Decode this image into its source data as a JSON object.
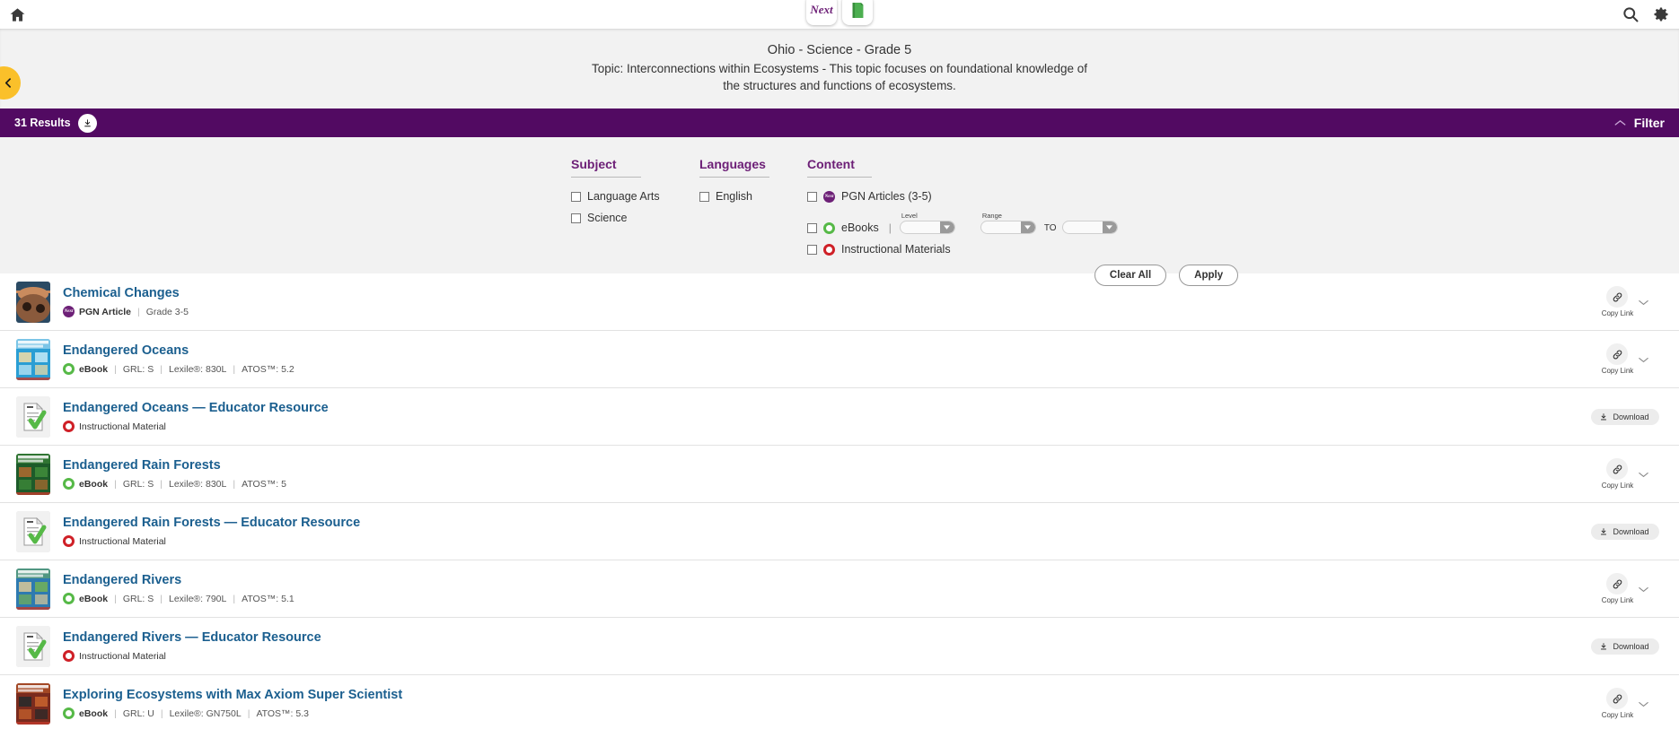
{
  "appbar": {
    "home_icon": "home-icon",
    "next_label": "Next",
    "book_icon": "green-book-icon",
    "search_icon": "search-icon",
    "settings_icon": "gear-icon"
  },
  "header": {
    "back_icon": "chevron-left-icon",
    "title": "Ohio - Science - Grade 5",
    "subtitle": "Topic: Interconnections within Ecosystems - This topic focuses on foundational knowledge of the structures and functions of ecosystems."
  },
  "resultsbar": {
    "count_label": "31 Results",
    "download_icon": "download-icon",
    "filter_label": "Filter",
    "filter_chevron": "chevron-up-icon",
    "bar_color": "#520a62"
  },
  "filters": {
    "subject": {
      "heading": "Subject",
      "options": [
        {
          "label": "Language Arts",
          "checked": false
        },
        {
          "label": "Science",
          "checked": false
        }
      ]
    },
    "languages": {
      "heading": "Languages",
      "options": [
        {
          "label": "English",
          "checked": false
        }
      ]
    },
    "content": {
      "heading": "Content",
      "options": [
        {
          "label": "PGN Articles (3-5)",
          "badge": "pgn-badge-icon",
          "checked": false
        },
        {
          "label": "eBooks",
          "badge": "ebook-badge-icon",
          "checked": false
        },
        {
          "label": "Instructional Materials",
          "badge": "instructional-material-badge-icon",
          "checked": false
        }
      ],
      "level_label": "Level",
      "level_value": "",
      "range_label": "Range",
      "range_from_value": "",
      "range_to_label": "TO",
      "range_to_value": ""
    },
    "clear_all_label": "Clear All",
    "apply_label": "Apply"
  },
  "results": [
    {
      "title": "Chemical Changes",
      "type": "PGN Article",
      "badge": "pgn",
      "meta": [
        "Grade 3-5"
      ],
      "action": "copylink",
      "thumb": "carousel-photo",
      "thumb_colors": [
        "#8a5a3c",
        "#c98b5e",
        "#2b4a63"
      ]
    },
    {
      "title": "Endangered Oceans",
      "type": "eBook",
      "badge": "ebook",
      "meta": [
        "GRL: S",
        "Lexile®: 830L",
        "ATOS™: 5.2"
      ],
      "action": "copylink",
      "thumb": "book-cover-oceans",
      "thumb_colors": [
        "#2a9ed4",
        "#bde5f5",
        "#e8d9a8"
      ]
    },
    {
      "title": "Endangered Oceans — Educator Resource",
      "type": "Instructional Material",
      "badge": "im",
      "meta": [],
      "action": "download",
      "thumb": "worksheet-check",
      "thumb_colors": [
        "#f2f2f2",
        "#ffffff",
        "#56b947"
      ]
    },
    {
      "title": "Endangered Rain Forests",
      "type": "eBook",
      "badge": "ebook",
      "meta": [
        "GRL: S",
        "Lexile®: 830L",
        "ATOS™: 5"
      ],
      "action": "copylink",
      "thumb": "book-cover-rainforests",
      "thumb_colors": [
        "#1d5b2a",
        "#3f8a3a",
        "#a8682f"
      ]
    },
    {
      "title": "Endangered Rain Forests — Educator Resource",
      "type": "Instructional Material",
      "badge": "im",
      "meta": [],
      "action": "download",
      "thumb": "worksheet-check",
      "thumb_colors": [
        "#f2f2f2",
        "#ffffff",
        "#56b947"
      ]
    },
    {
      "title": "Endangered Rivers",
      "type": "eBook",
      "badge": "ebook",
      "meta": [
        "GRL: S",
        "Lexile®: 790L",
        "ATOS™: 5.1"
      ],
      "action": "copylink",
      "thumb": "book-cover-rivers",
      "thumb_colors": [
        "#2e7ab0",
        "#6fae5c",
        "#d0c49a"
      ]
    },
    {
      "title": "Endangered Rivers — Educator Resource",
      "type": "Instructional Material",
      "badge": "im",
      "meta": [],
      "action": "download",
      "thumb": "worksheet-check",
      "thumb_colors": [
        "#f2f2f2",
        "#ffffff",
        "#56b947"
      ]
    },
    {
      "title": "Exploring Ecosystems with Max Axiom Super Scientist",
      "type": "eBook",
      "badge": "ebook",
      "meta": [
        "GRL: U",
        "Lexile®: GN750L",
        "ATOS™: 5.3"
      ],
      "action": "copylink",
      "thumb": "book-cover-maxaxiom",
      "thumb_colors": [
        "#7a2b1e",
        "#c4602c",
        "#2a2a2a"
      ]
    }
  ],
  "row_actions": {
    "copy_link_label": "Copy Link",
    "copy_link_icon": "link-icon",
    "expand_icon": "chevron-down-icon",
    "download_label": "Download",
    "download_icon": "download-icon"
  }
}
